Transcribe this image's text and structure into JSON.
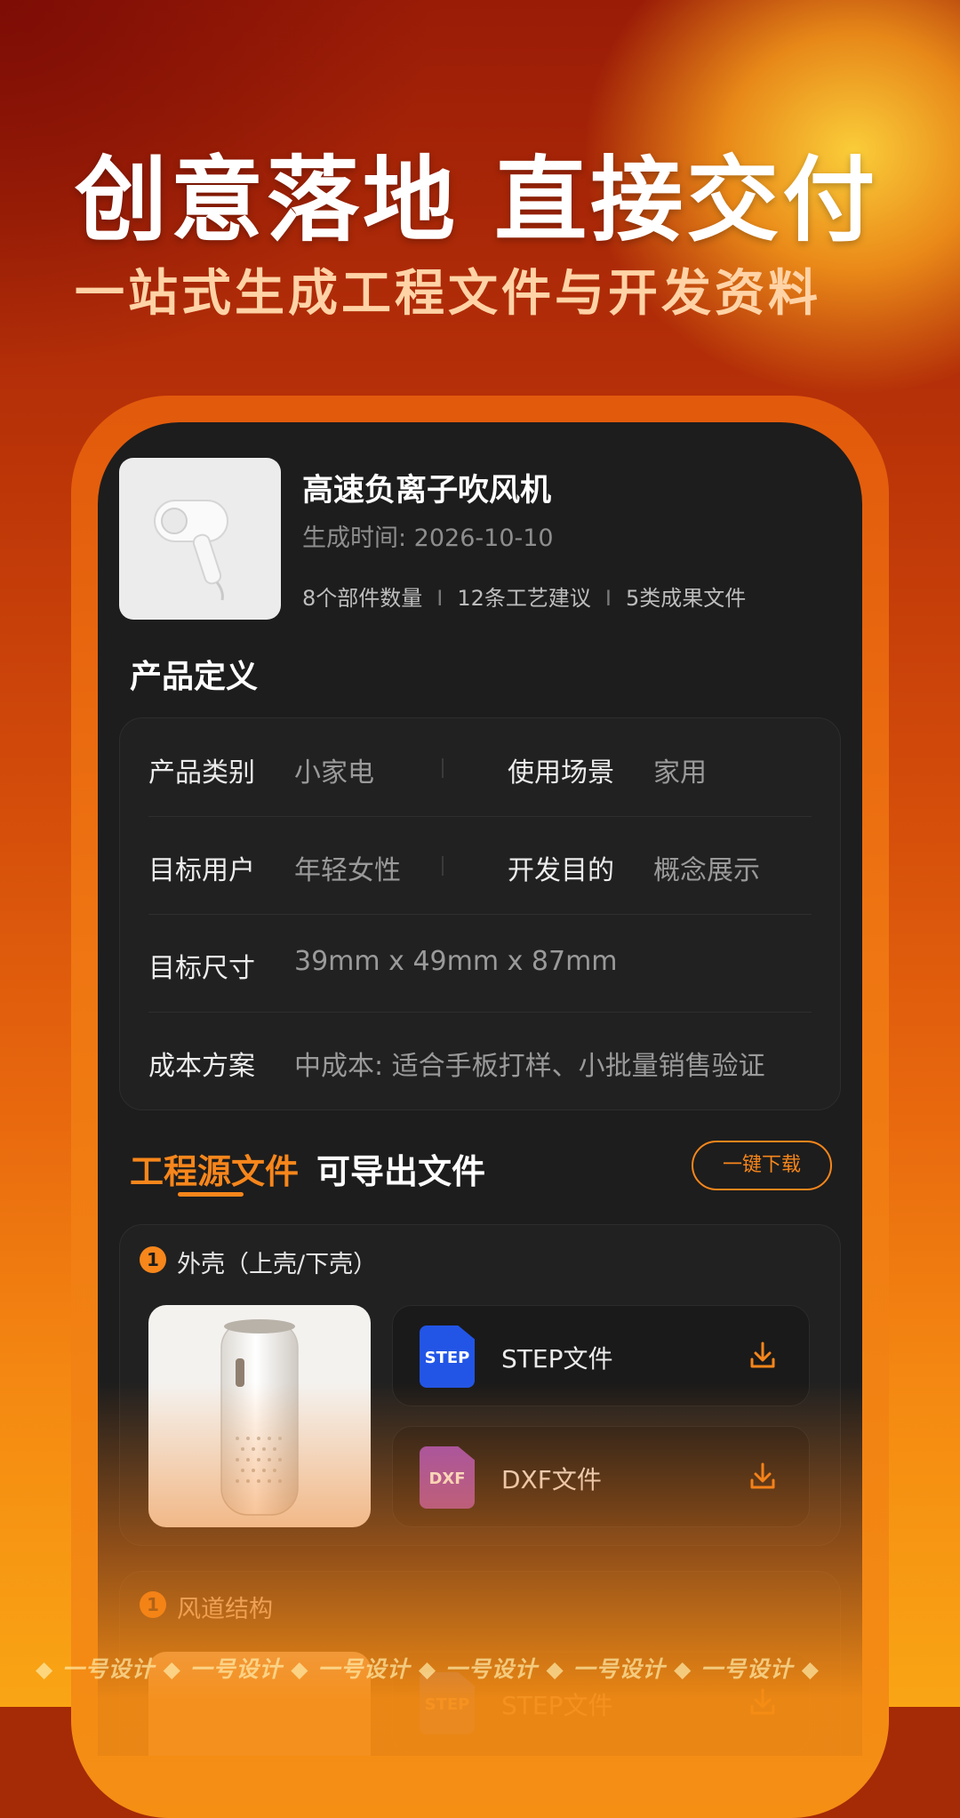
{
  "hero": {
    "headline": "创意落地 直接交付",
    "subline": "一站式生成工程文件与开发资料"
  },
  "product": {
    "title": "高速负离子吹风机",
    "date": "生成时间: 2026-10-10",
    "stats": [
      "8个部件数量",
      "12条工艺建议",
      "5类成果文件"
    ],
    "stat_separator": "I"
  },
  "definition": {
    "section_title": "产品定义",
    "rows": [
      {
        "label_a": "产品类别",
        "value_a": "小家电",
        "label_b": "使用场景",
        "value_b": "家用"
      },
      {
        "label_a": "目标用户",
        "value_a": "年轻女性",
        "label_b": "开发目的",
        "value_b": "概念展示"
      },
      {
        "label_a": "目标尺寸",
        "value_a": "39mm x 49mm x 87mm"
      },
      {
        "label_a": "成本方案",
        "value_a": "中成本: 适合手板打样、小批量销售验证"
      }
    ]
  },
  "tabs": {
    "active": "工程源文件",
    "inactive": "可导出文件",
    "download_all": "一键下载"
  },
  "groups": [
    {
      "index": "1",
      "title": "外壳（上壳/下壳）",
      "image_icon": "air-purifier-render",
      "files": [
        {
          "icon_text": "STEP",
          "label": "STEP文件",
          "icon_color": "#2255e6"
        },
        {
          "icon_text": "DXF",
          "label": "DXF文件",
          "icon_color": "#9a4dbf"
        }
      ]
    },
    {
      "index": "1",
      "title": "风道结构",
      "files": [
        {
          "icon_text": "STEP",
          "label": "STEP文件",
          "icon_color": "#2255e6"
        }
      ]
    }
  ],
  "watermark": "◆ 一号设计 ◆ 一号设计 ◆ 一号设计 ◆ 一号设计 ◆ 一号设计 ◆ 一号设计 ◆",
  "colors": {
    "accent": "#f7861b",
    "screen_bg": "#1d1d1d",
    "card_bg": "#212121"
  }
}
